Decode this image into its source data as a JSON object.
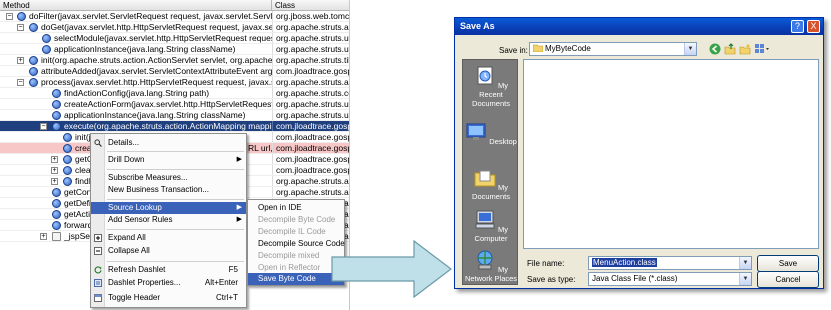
{
  "tree": {
    "headers": {
      "method": "Method",
      "class": "Class"
    },
    "rows": [
      {
        "method": "doFilter(javax.servlet.ServletRequest request, javax.servlet.ServletResp",
        "class": "org.jboss.web.tomcat.f"
      },
      {
        "method": "doGet(javax.servlet.http.HttpServletRequest request, javax.servlet.",
        "class": "org.apache.struts.actio"
      },
      {
        "method": "selectModule(javax.servlet.http.HttpServletRequest request, java",
        "class": "org.apache.struts.util.R"
      },
      {
        "method": "applicationInstance(java.lang.String className)",
        "class": "org.apache.struts.util.R"
      },
      {
        "method": "init(org.apache.struts.action.ActionServlet servlet, org.apache.struts.",
        "class": "org.apache.struts.tiles."
      },
      {
        "method": "attributeAdded(javax.servlet.ServletContextAttributeEvent arg)",
        "class": "com.jloadtrace.gospace"
      },
      {
        "method": "process(javax.servlet.http.HttpServletRequest request, javax.servlet.",
        "class": "org.apache.struts.actio"
      },
      {
        "method": "findActionConfig(java.lang.String path)",
        "class": "org.apache.struts.confi"
      },
      {
        "method": "createActionForm(javax.servlet.http.HttpServletRequest reque",
        "class": "org.apache.struts.util.R"
      },
      {
        "method": "applicationInstance(java.lang.String className)",
        "class": "org.apache.struts.util.R"
      },
      {
        "method": "execute(org.apache.struts.action.ActionMapping mapping, org",
        "class": "com.jloadtrace.gospace"
      },
      {
        "method": "init(ja",
        "class": "com.jloadtrace.gospace"
      },
      {
        "method": "creat",
        "tail": "RL url,",
        "class": "com.jloadtrace.gospace"
      },
      {
        "method": "getO",
        "class": "com.jloadtrace.gospace"
      },
      {
        "method": "clear",
        "class": "com.jloadtrace.gospace"
      },
      {
        "method": "findF",
        "class": "org.apache.struts.actio"
      },
      {
        "method": "getCont",
        "class": "org.apache.struts.actio"
      },
      {
        "method": "getDefir",
        "class": "org.apache.struts.actio"
      },
      {
        "method": "getActio",
        "class": "org.apache.struts.actio"
      },
      {
        "method": "forwardI",
        "class": "org.apache.struts.actio"
      },
      {
        "method": "_jspServ",
        "class": "org.apache.struts.actio"
      }
    ]
  },
  "context_menu": {
    "details": "Details...",
    "drill_down": "Drill Down",
    "subscribe": "Subscribe Measures...",
    "new_bt": "New Business Transaction...",
    "source_lookup": "Source Lookup",
    "add_sensor": "Add Sensor Rules",
    "expand_all": "Expand All",
    "collapse_all": "Collapse All",
    "refresh": "Refresh Dashlet",
    "refresh_sc": "F5",
    "properties": "Dashlet Properties...",
    "properties_sc": "Alt+Enter",
    "toggle_header": "Toggle Header",
    "toggle_header_sc": "Ctrl+T"
  },
  "submenu": {
    "open_ide": "Open in IDE",
    "decompile_byte": "Decompile Byte Code",
    "decompile_il": "Decompile IL Code",
    "decompile_source": "Decompile Source Code",
    "decompile_mixed": "Decompile mixed",
    "open_reflector": "Open in Reflector",
    "save_byte": "Save Byte Code"
  },
  "dialog": {
    "title": "Save As",
    "title_btn_help": "?",
    "title_btn_close": "X",
    "save_in_label": "Save in:",
    "save_in_value": "MyByteCode",
    "places": {
      "recent": "My Recent Documents",
      "desktop": "Desktop",
      "documents": "My Documents",
      "computer": "My Computer",
      "network": "My Network Places"
    },
    "file_name_label": "File name:",
    "file_name_value": "MenuAction.class",
    "save_type_label": "Save as type:",
    "save_type_value": "Java Class File (*.class)",
    "save_btn": "Save",
    "cancel_btn": "Cancel"
  },
  "colors": {
    "selection": "#1f3f7f",
    "menu_highlight": "#3a62b8",
    "dialog_title": "#0a4fc8",
    "arrow_fill": "#bfe0e8"
  }
}
